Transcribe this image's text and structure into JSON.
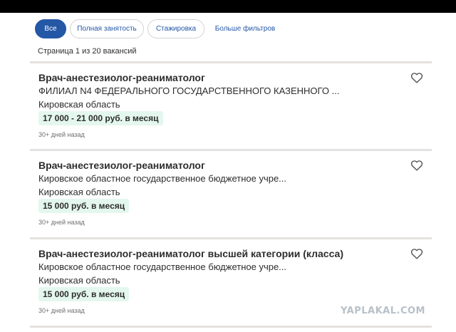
{
  "filters": {
    "all": "Все",
    "full_time": "Полная занятость",
    "internship": "Стажировка",
    "more": "Больше фильтров"
  },
  "page_info": "Страница 1 из 20 вакансий",
  "jobs": [
    {
      "title": "Врач-анестезиолог-реаниматолог",
      "company": "ФИЛИАЛ N4 ФЕДЕРАЛЬНОГО ГОСУДАРСТВЕННОГО КАЗЕННОГО ...",
      "location": "Кировская область",
      "salary": "17 000 - 21 000 руб. в месяц",
      "posted": "30+ дней назад"
    },
    {
      "title": "Врач-анестезиолог-реаниматолог",
      "company": "Кировское областное государственное бюджетное учре...",
      "location": "Кировская область",
      "salary": "15 000 руб. в месяц",
      "posted": "30+ дней назад"
    },
    {
      "title": "Врач-анестезиолог-реаниматолог высшей категории (класса)",
      "company": "Кировское областное государственное бюджетное учре...",
      "location": "Кировская область",
      "salary": "15 000 руб. в месяц",
      "posted": "30+ дней назад"
    }
  ],
  "icons": {
    "save": "heart-icon"
  },
  "colors": {
    "accent": "#2557a7",
    "salary_bg": "#e4f7ee"
  },
  "watermark": "YAPLAKAL.COM"
}
